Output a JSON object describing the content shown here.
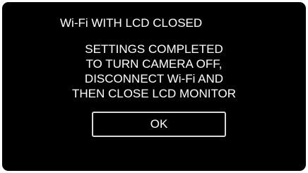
{
  "dialog": {
    "title": "Wi-Fi WITH LCD CLOSED",
    "message_lines": [
      "SETTINGS COMPLETED",
      "TO TURN CAMERA OFF,",
      "DISCONNECT Wi-Fi AND",
      "THEN CLOSE LCD MONITOR"
    ],
    "ok_label": "OK"
  },
  "colors": {
    "screen_background": "#000000",
    "text": "#ffffff",
    "button_border": "#d8d8d8"
  }
}
